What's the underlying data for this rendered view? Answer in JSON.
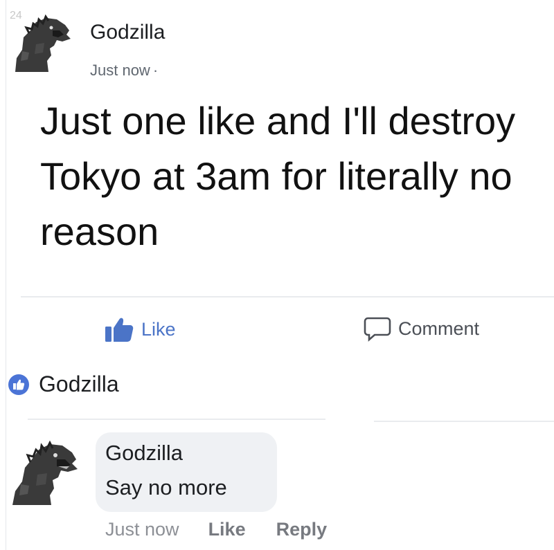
{
  "corner_label": "24",
  "post": {
    "author": "Godzilla",
    "timestamp": "Just now",
    "separator": "·",
    "text": "Just one like and I'll destroy Tokyo at 3am for literally no reason",
    "like_label": "Like",
    "comment_label": "Comment"
  },
  "likes": {
    "liker_name": "Godzilla"
  },
  "comment": {
    "author": "Godzilla",
    "text": "Say no more",
    "timestamp": "Just now",
    "like_label": "Like",
    "reply_label": "Reply"
  },
  "colors": {
    "like_blue": "#4b74c7",
    "bubble_bg": "#eff1f4",
    "meta_gray": "#606770"
  },
  "icons": {
    "post_avatar": "godzilla-avatar",
    "like": "thumbs-up-icon",
    "comment": "speech-bubble-icon",
    "like_badge": "thumbs-up-badge-icon"
  }
}
